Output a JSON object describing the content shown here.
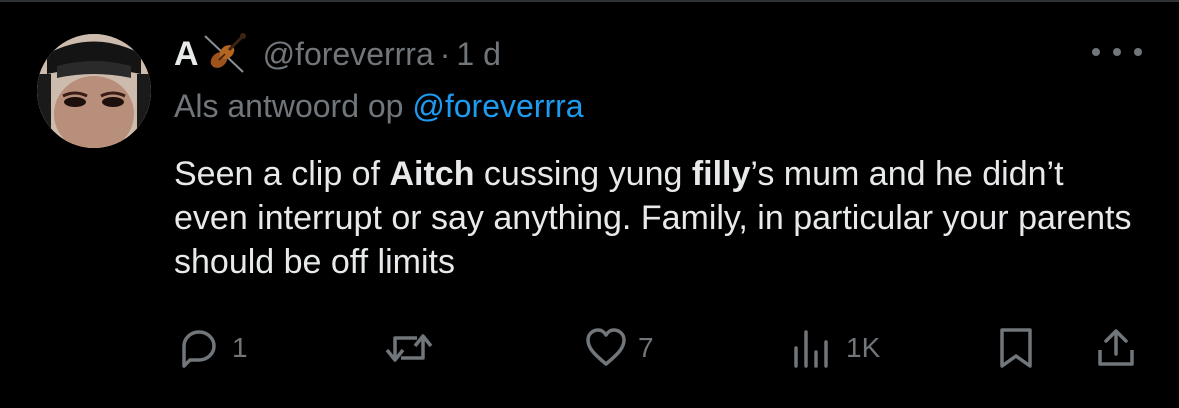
{
  "tweet": {
    "display_name": "A",
    "handle": "@foreverrra",
    "separator": "·",
    "time": "1 d",
    "reply_prefix": "Als antwoord op",
    "reply_to": "@foreverrra",
    "text_parts": {
      "p1": "Seen a clip of ",
      "b1": "Aitch",
      "p2": " cussing yung ",
      "b2": "filly",
      "p3": "’s mum and he didn’t even interrupt or say anything. Family, in particular your parents should be off limits"
    },
    "name_emoji_icon": "violin-icon"
  },
  "actions": {
    "reply_count": "1",
    "retweet_count": "",
    "like_count": "7",
    "views_count": "1K"
  },
  "colors": {
    "background": "#000000",
    "text": "#e7e9ea",
    "muted": "#71767b",
    "link": "#1d9bf0"
  }
}
